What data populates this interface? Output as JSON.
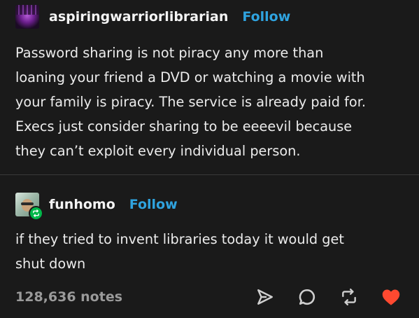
{
  "post": {
    "author": "aspiringwarriorlibrarian",
    "follow_label": "Follow",
    "body_lines": [
      "Password sharing is not piracy any more than",
      "loaning your friend a DVD or watching a movie with",
      "your family is piracy. The service is already paid for.",
      "Execs just consider sharing to be eeeevil because",
      "they can’t exploit every individual person."
    ]
  },
  "reblog": {
    "author": "funhomo",
    "follow_label": "Follow",
    "body_lines": [
      "if they tried to invent libraries today it would get",
      "shut down"
    ]
  },
  "footer": {
    "notes": "128,636 notes",
    "actions": [
      "share-icon",
      "reply-icon",
      "reblog-icon",
      "like-icon"
    ]
  },
  "colors": {
    "background": "#1a1a1a",
    "follow_link": "#2fa3df",
    "like": "#ff4930",
    "reblog_badge": "#00b84a"
  }
}
